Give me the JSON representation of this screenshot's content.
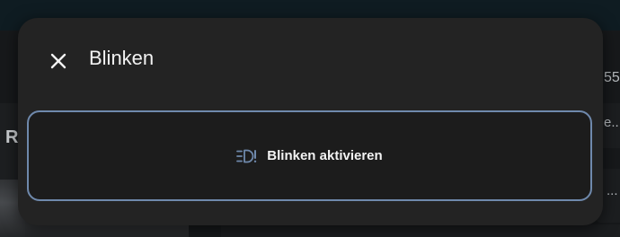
{
  "dialog": {
    "title": "Blinken",
    "close_icon": "close-icon",
    "action": {
      "label": "Blinken aktivieren",
      "icon": "headlight-flash-icon",
      "border_color": "#6f89ac",
      "icon_color": "#6f89ac"
    }
  },
  "background": {
    "left_letter": "R",
    "right_number": "55",
    "right_text_1": "e..",
    "right_text_2": "..."
  }
}
